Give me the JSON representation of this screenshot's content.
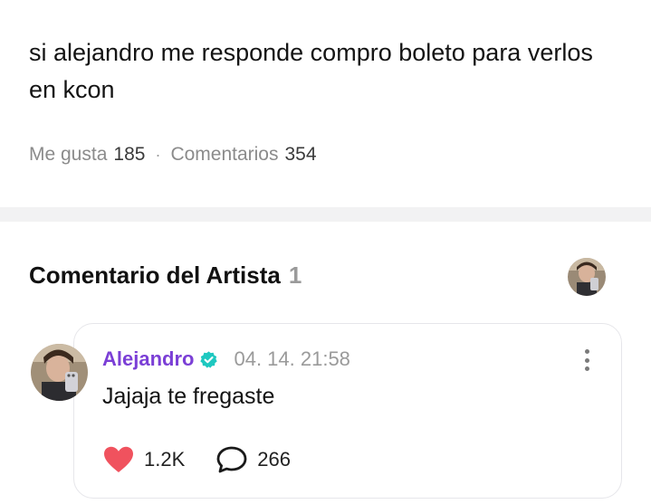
{
  "post": {
    "text": "si alejandro me responde compro boleto para verlos en kcon",
    "likes_label": "Me gusta",
    "likes_count": "185",
    "separator": "·",
    "comments_label": "Comentarios",
    "comments_count": "354"
  },
  "artist_section": {
    "title": "Comentario del Artista",
    "count": "1"
  },
  "comment": {
    "author": "Alejandro",
    "timestamp": "04. 14. 21:58",
    "text": "Jajaja te fregaste",
    "like_count": "1.2K",
    "reply_count": "266"
  },
  "colors": {
    "author": "#7b3fd6",
    "verified": "#1ec8c0",
    "heart": "#f0525e",
    "divider": "#f2f2f3"
  },
  "icons": {
    "verified": "verified-badge-icon",
    "more": "more-vertical-icon",
    "like": "heart-icon",
    "reply": "speech-bubble-icon"
  }
}
